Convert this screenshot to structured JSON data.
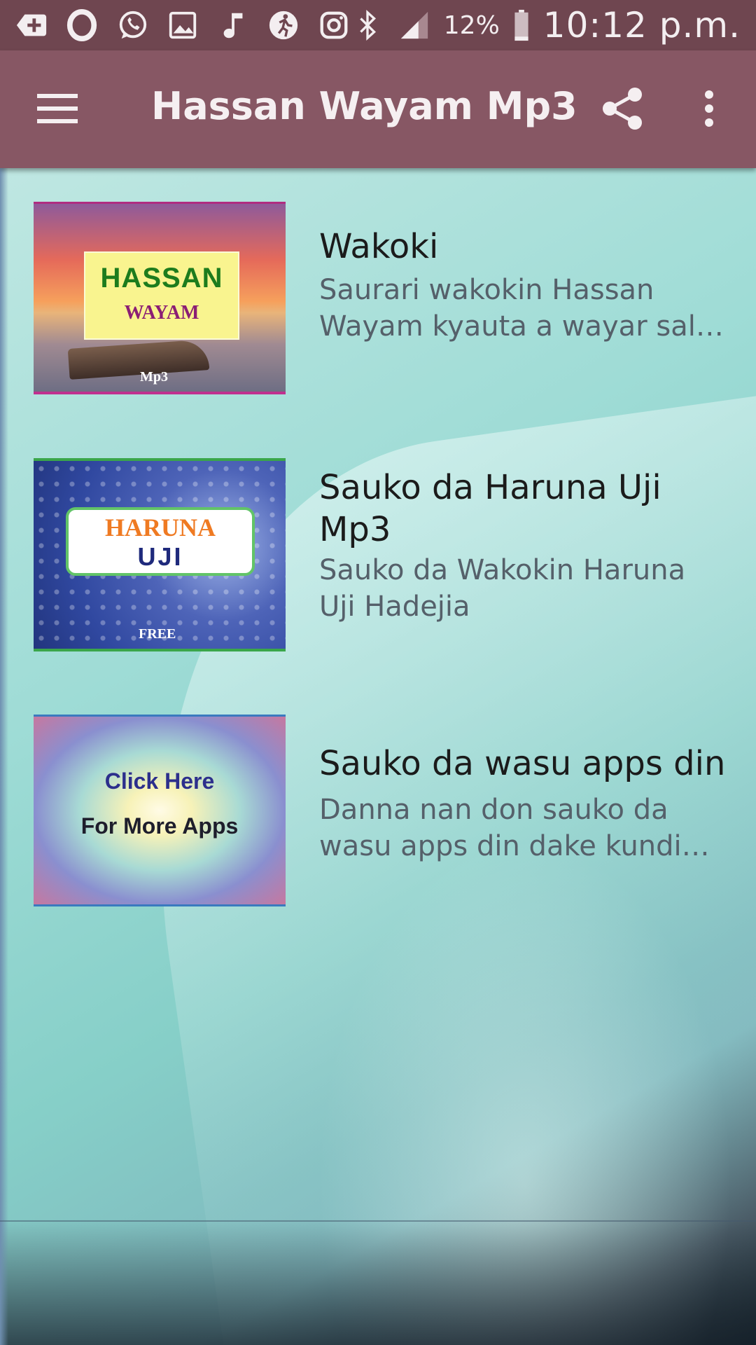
{
  "status_bar": {
    "icons": [
      "plus-icon",
      "opera-icon",
      "whatsapp-icon",
      "gallery-icon",
      "music-icon",
      "runner-icon",
      "instagram-icon",
      "bluetooth-icon",
      "signal-icon",
      "battery-icon"
    ],
    "battery_percent": "12%",
    "time": "10:12 p.m."
  },
  "app_bar": {
    "title": "Hassan Wayam Mp3",
    "icons": [
      "menu-icon",
      "share-icon",
      "more-vert-icon"
    ]
  },
  "items": [
    {
      "title": "Wakoki",
      "description": "Saurari wakokin Hassan Wayam kyauta a wayar sal…",
      "thumb_line1": "HASSAN",
      "thumb_line2": "WAYAM",
      "thumb_line3": "Mp3"
    },
    {
      "title": "Sauko da Haruna Uji Mp3",
      "description": "Sauko da Wakokin Haruna Uji Hadejia",
      "thumb_line1": "HARUNA",
      "thumb_line2": "UJI",
      "thumb_line3": "FREE"
    },
    {
      "title": "Sauko da wasu apps din",
      "description": "Danna nan don sauko da wasu apps din dake kundi…",
      "thumb_line1": "Click Here",
      "thumb_line2": "For More Apps"
    }
  ],
  "colors": {
    "status_bar": "#6f4650",
    "app_bar": "#875764",
    "title_text": "#1b1b1b",
    "description_text": "#55606a"
  }
}
